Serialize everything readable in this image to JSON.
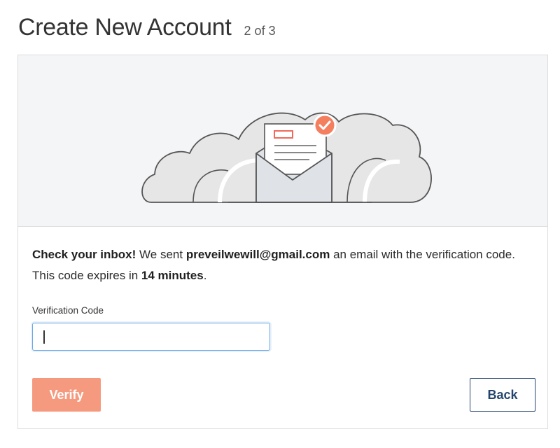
{
  "header": {
    "title": "Create New Account",
    "step": "2 of 3"
  },
  "message": {
    "lead": "Check your inbox!",
    "sent_prefix": " We sent ",
    "email": "preveilwewill@gmail.com",
    "sent_suffix": " an email with the verification code. This code expires in ",
    "expiry": "14 minutes",
    "end": "."
  },
  "form": {
    "label": "Verification Code",
    "value": "",
    "placeholder": ""
  },
  "buttons": {
    "verify": "Verify",
    "back": "Back"
  },
  "illustration": {
    "icon": "envelope-cloud-illustration",
    "badge_icon": "check-badge-icon",
    "colors": {
      "badge": "#f47f5f",
      "cloud": "#e6e6e6",
      "outline": "#555555",
      "envelope": "#dfe3e8",
      "letter_mark": "#f06a5a"
    }
  },
  "colors": {
    "verify_button": "#f59a7f",
    "back_button_text": "#24466e",
    "input_focus": "#6aa6e6",
    "hero_background": "#f4f5f7"
  }
}
